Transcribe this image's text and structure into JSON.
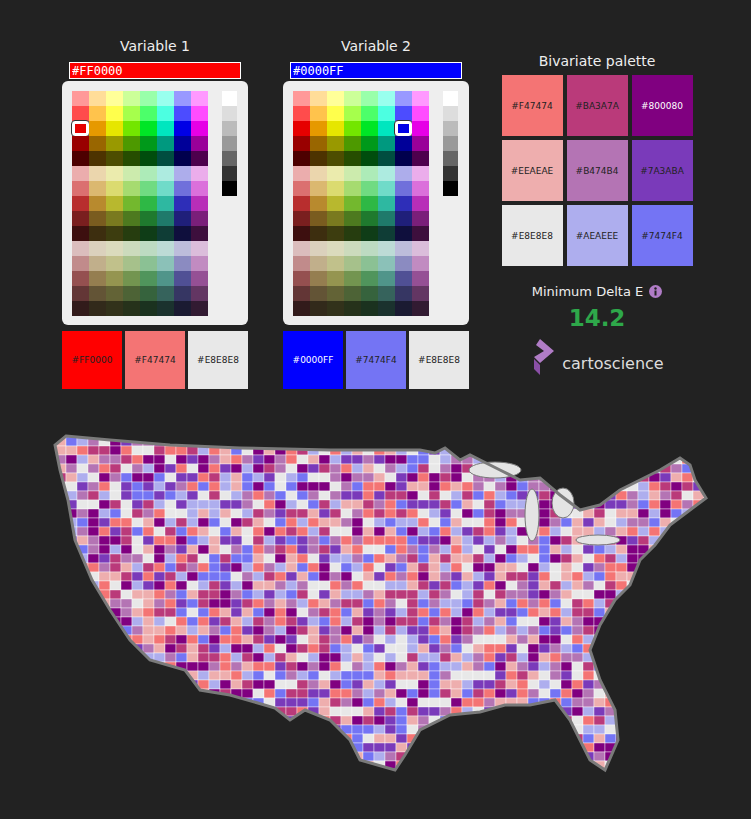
{
  "variables": [
    {
      "title": "Variable 1",
      "hex": "#FF0000",
      "selected_row": 2,
      "selected_col": 0,
      "ramp": [
        {
          "label": "#FF0000",
          "color": "#FF0000"
        },
        {
          "label": "#F47474",
          "color": "#F47474"
        },
        {
          "label": "#E8E8E8",
          "color": "#E8E8E8"
        }
      ]
    },
    {
      "title": "Variable 2",
      "hex": "#0000FF",
      "selected_row": 2,
      "selected_col": 6,
      "ramp": [
        {
          "label": "#0000FF",
          "color": "#0000FF"
        },
        {
          "label": "#7474F4",
          "color": "#7474F4"
        },
        {
          "label": "#E8E8E8",
          "color": "#E8E8E8"
        }
      ]
    }
  ],
  "bivariate": {
    "title": "Bivariate palette",
    "cells": [
      {
        "label": "#F47474",
        "color": "#F47474"
      },
      {
        "label": "#BA3A7A",
        "color": "#BA3A7A"
      },
      {
        "label": "#800080",
        "color": "#800080"
      },
      {
        "label": "#EEAEAE",
        "color": "#EEAEAE"
      },
      {
        "label": "#B474B4",
        "color": "#B474B4"
      },
      {
        "label": "#7A3ABA",
        "color": "#7A3ABA"
      },
      {
        "label": "#E8E8E8",
        "color": "#E8E8E8"
      },
      {
        "label": "#AEAEEE",
        "color": "#AEAEEE"
      },
      {
        "label": "#7474F4",
        "color": "#7474F4"
      }
    ]
  },
  "delta_e": {
    "label": "Minimum Delta E",
    "value": "14.2"
  },
  "logo": {
    "text": "cartoscience"
  }
}
